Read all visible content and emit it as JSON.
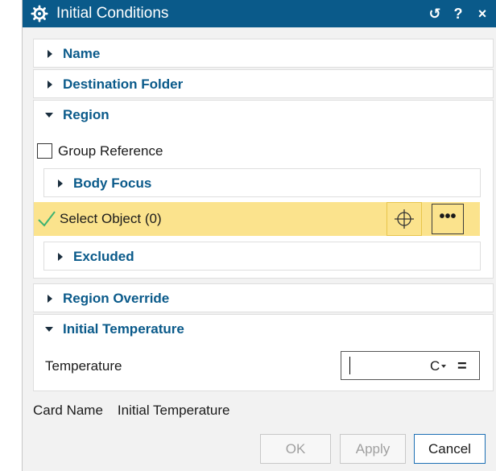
{
  "dialog": {
    "title": "Initial Conditions",
    "icons": [
      "gear-icon",
      "reset-icon",
      "help-icon",
      "close-icon"
    ],
    "reset_glyph": "↺",
    "help_glyph": "?",
    "close_glyph": "×"
  },
  "sections": {
    "name": {
      "title": "Name",
      "expanded": false
    },
    "destination_folder": {
      "title": "Destination Folder",
      "expanded": false
    },
    "region": {
      "title": "Region",
      "expanded": true,
      "group_reference": {
        "label": "Group Reference",
        "checked": false
      },
      "body_focus": {
        "title": "Body Focus",
        "expanded": false
      },
      "select_object": {
        "label": "Select Object (0)",
        "more_glyph": "•••"
      },
      "excluded": {
        "title": "Excluded",
        "expanded": false
      }
    },
    "region_override": {
      "title": "Region Override",
      "expanded": false
    },
    "initial_temperature": {
      "title": "Initial Temperature",
      "expanded": true,
      "temperature_label": "Temperature",
      "temperature_value": "",
      "unit": "C",
      "formula_glyph": "="
    }
  },
  "card": {
    "label": "Card Name",
    "value": "Initial Temperature"
  },
  "buttons": {
    "ok": "OK",
    "apply": "Apply",
    "cancel": "Cancel"
  },
  "colors": {
    "title_bar": "#0a5a8a",
    "section_title": "#0a5a8a",
    "selection_highlight": "#fbe38d",
    "check_green": "#3cb371",
    "cancel_border": "#1c6fb4"
  }
}
